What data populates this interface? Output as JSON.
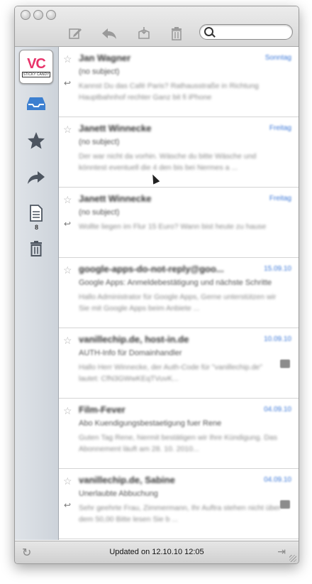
{
  "toolbar": {
    "search": {
      "placeholder": "",
      "value": ""
    }
  },
  "icons": {
    "close": "window-close-icon",
    "minimize": "window-minimize-icon",
    "zoom": "window-zoom-icon",
    "compose": "compose-icon",
    "reply": "reply-icon",
    "archive": "archive-icon",
    "trash": "trash-icon",
    "search": "search-icon"
  },
  "sidebar": {
    "avatar": {
      "text": "VC",
      "subtext": "STICKY CANDY"
    },
    "items": [
      {
        "name": "inbox",
        "icon": "inbox-icon"
      },
      {
        "name": "starred",
        "icon": "star-icon"
      },
      {
        "name": "sent",
        "icon": "forward-arrow-icon"
      },
      {
        "name": "drafts",
        "icon": "document-icon",
        "badge": "8"
      },
      {
        "name": "trash",
        "icon": "trash-icon"
      }
    ]
  },
  "messages": [
    {
      "sender": "Jan Wagner",
      "date": "Sonntag",
      "subject": "(no subject)",
      "preview": "Kannst Du das Café Paris? Rathausstraße in Richtung Hauptbahnhof rechter Ganz bit fi iPhone",
      "replied": true,
      "attachment": false
    },
    {
      "sender": "Janett Winnecke",
      "date": "Freitag",
      "subject": "(no subject)",
      "preview": "Der war nicht da vorhin. Wäsche du bitte Wäsche und könntest eventuell die 4 den bis bei Nermes a ...",
      "replied": false,
      "attachment": false
    },
    {
      "sender": "Janett Winnecke",
      "date": "Freitag",
      "subject": "(no subject)",
      "preview": "Wollte liegen im Flur 15 Euro? Wann bist heute zu hause",
      "replied": true,
      "attachment": false
    },
    {
      "sender": "google-apps-do-not-reply@goo...",
      "date": "15.09.10",
      "subject": "Google Apps: Anmeldebestätigung und nächste Schritte",
      "preview": "Hallo Administrator für Google Apps, Gerne unterstützen wir Sie mit Google Apps beim Anbiete ...",
      "replied": false,
      "attachment": false
    },
    {
      "sender": "vanillechip.de, host-in.de",
      "date": "10.09.10",
      "subject": "AUTH-Info für Domainhandler",
      "preview": "Hallo Herr Winnecke, der Auth-Code für \"vanillechip.de\" lautet: CfN3GWwKEqTVuvK...",
      "replied": false,
      "attachment": true
    },
    {
      "sender": "Film-Fever",
      "date": "04.09.10",
      "subject": "Abo Kuendigungsbestaetigung fuer Rene",
      "preview": "Guten Tag Rene, hiermit bestätigen wir Ihre Kündigung. Das Abonnement läuft am 28. 10. 2010...",
      "replied": false,
      "attachment": false
    },
    {
      "sender": "vanillechip.de, Sabine",
      "date": "04.09.10",
      "subject": "Unerlaubte Abbuchung",
      "preview": "Sehr geehrte Frau, Zimmermann, Ihr Auftra stehen nicht über dem 50,00 Bitte lesen Sie b ...",
      "replied": true,
      "attachment": true
    }
  ],
  "statusbar": {
    "status": "Updated on 12.10.10 12:05"
  }
}
